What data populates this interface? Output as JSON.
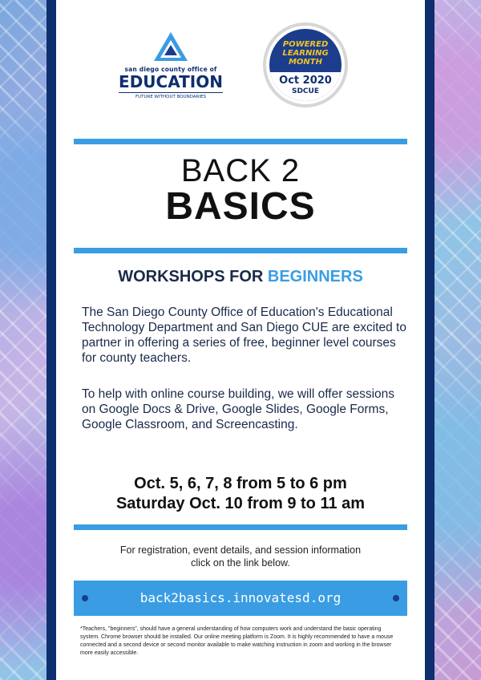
{
  "header": {
    "sdcoe": {
      "top": "san diego county office of",
      "big": "EDUCATION",
      "tagline": "FUTURE WITHOUT BOUNDARIES"
    },
    "badge": {
      "line1": "POWERED",
      "line2": "LEARNING",
      "line3": "MONTH",
      "year": "Oct 2020",
      "org": "SDCUE"
    }
  },
  "title": {
    "line1": "BACK 2",
    "line2": "BASICS"
  },
  "subtitle": {
    "part1": "WORKSHOPS FOR ",
    "highlight": "BEGINNERS"
  },
  "body": {
    "p1": "The San Diego County Office of Education's Educational Technology Department and San Diego CUE are excited to partner in offering a series of free, beginner level courses for county teachers.",
    "p2": "To help with online course building, we will offer sessions on Google Docs & Drive, Google Slides, Google Forms, Google Classroom, and Screencasting."
  },
  "dates": {
    "line1": "Oct. 5, 6, 7, 8 from 5 to 6 pm",
    "line2": "Saturday Oct. 10 from 9 to 11 am"
  },
  "registration": "For registration, event details, and session information click on the link below.",
  "link": "back2basics.innovatesd.org",
  "footnote": "*Teachers, \"beginners\", should have a general understanding of how computers work and understand the basic operating system. Chrome browser should be installed. Our online meeting platform is Zoom. It is highly recommended to have a mouse connected and a second device or second monitor available to make watching instruction in zoom and working in the browser more easily accessible.",
  "colors": {
    "navy": "#0f2e6e",
    "accent": "#3a9de3",
    "gold": "#f3c224"
  }
}
